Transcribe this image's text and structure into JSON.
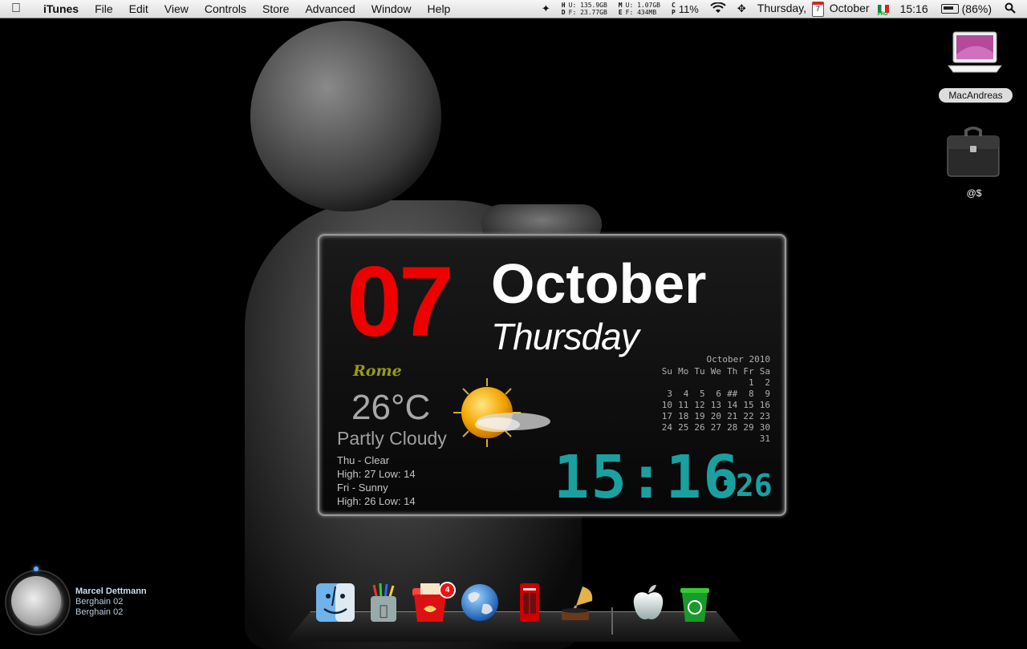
{
  "menubar": {
    "app": "iTunes",
    "menus": [
      "File",
      "Edit",
      "View",
      "Controls",
      "Store",
      "Advanced",
      "Window",
      "Help"
    ],
    "disk": {
      "label_top": "H",
      "label_bottom": "D",
      "used": "U: 135.9GB",
      "free": "F: 23.77GB"
    },
    "memory": {
      "label_top": "M",
      "label_bottom": "E",
      "used": "U: 1.07GB",
      "free": "F: 434MB"
    },
    "cpu": {
      "label_top": "C",
      "label_bottom": "P",
      "value": "11%"
    },
    "date_weekday": "Thursday,",
    "date_calendar_day": "7",
    "date_month": "October",
    "time": "15:16",
    "battery": "(86%)"
  },
  "widget": {
    "day": "07",
    "month": "October",
    "weekday": "Thursday",
    "city": "Rome",
    "temperature": "26°C",
    "condition": "Partly Cloudy",
    "forecast": [
      "Thu - Clear",
      "High: 27 Low: 14",
      "Fri - Sunny",
      "High: 26 Low: 14"
    ],
    "calendar": {
      "title": "October 2010",
      "headers": [
        "Su",
        "Mo",
        "Tu",
        "We",
        "Th",
        "Fr",
        "Sa"
      ],
      "weeks": [
        [
          "",
          "",
          "",
          "",
          "",
          "1",
          "2"
        ],
        [
          "3",
          "4",
          "5",
          "6",
          "##",
          "8",
          "9"
        ],
        [
          "10",
          "11",
          "12",
          "13",
          "14",
          "15",
          "16"
        ],
        [
          "17",
          "18",
          "19",
          "20",
          "21",
          "22",
          "23"
        ],
        [
          "24",
          "25",
          "26",
          "27",
          "28",
          "29",
          "30"
        ],
        [
          "",
          "",
          "",
          "",
          "",
          "",
          "31"
        ]
      ]
    },
    "clock_hm": "15:16",
    "clock_sec": ":26"
  },
  "desktop": {
    "laptop_label": "MacAndreas",
    "briefcase_label": "@$"
  },
  "now_playing": {
    "artist": "Marcel Dettmann",
    "album": "Berghain 02",
    "track": "Berghain 02"
  },
  "dock": {
    "badge": "4",
    "items": [
      "finder-icon",
      "pencil-cup-icon",
      "mail-basket-icon",
      "globe-icon",
      "phone-booth-icon",
      "gramophone-icon",
      "apple-icon",
      "trash-icon"
    ]
  },
  "colors": {
    "day_red": "#e00000",
    "clock_teal": "#1aa0a0",
    "city_olive": "#9a9a14"
  }
}
